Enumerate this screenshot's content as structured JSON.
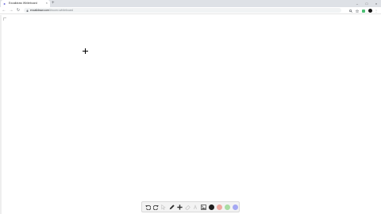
{
  "browser": {
    "tab": {
      "title": "Excalidraw Whiteboard",
      "close_glyph": "×"
    },
    "new_tab_glyph": "+",
    "window_controls": [
      "–",
      "□",
      "×"
    ],
    "nav": {
      "back_glyph": "←",
      "forward_glyph": "→",
      "reload_glyph": "↻"
    },
    "address_bar": {
      "host": "excalidraw.com",
      "path": "/#room=whiteboard"
    },
    "toolbar_icons": [
      "zoom-icon",
      "star-icon",
      "extension-icon",
      "profile-avatar",
      "menu-icon"
    ],
    "menu_glyph": "⋮"
  },
  "drawing_toolbar": {
    "tools": [
      {
        "name": "undo-icon",
        "glyph": "↶",
        "enabled": true
      },
      {
        "name": "redo-icon",
        "glyph": "↷",
        "enabled": true
      },
      {
        "name": "selection-icon",
        "glyph": "↖",
        "enabled": false
      },
      {
        "name": "pen-icon",
        "glyph": "✎",
        "enabled": true
      },
      {
        "name": "add-shape-icon",
        "glyph": "+",
        "enabled": true
      },
      {
        "name": "eraser-icon",
        "glyph": "⌫",
        "enabled": false
      },
      {
        "name": "text-icon",
        "glyph": "A",
        "enabled": false
      },
      {
        "name": "image-icon",
        "glyph": "▣",
        "enabled": true
      }
    ],
    "colors": [
      {
        "name": "black",
        "hex": "#1e1e1e"
      },
      {
        "name": "pink",
        "hex": "#f0a8a0"
      },
      {
        "name": "green",
        "hex": "#a9dca3"
      },
      {
        "name": "purple",
        "hex": "#a5a8f3"
      }
    ]
  },
  "colors": {
    "tab_strip": "#dee1e6",
    "omnibox": "#f1f3f4",
    "canvas": "#ffffff",
    "favicon": "#6965db"
  }
}
